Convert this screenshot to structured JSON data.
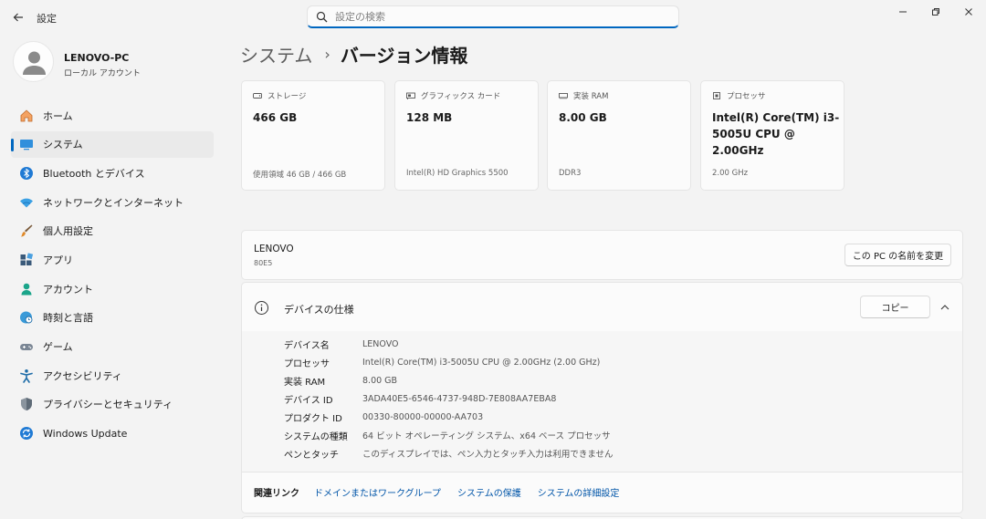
{
  "window": {
    "title": "設定"
  },
  "search": {
    "placeholder": "設定の検索"
  },
  "profile": {
    "name": "LENOVO-PC",
    "account_type": "ローカル アカウント"
  },
  "sidebar": {
    "items": [
      {
        "label": "ホーム",
        "icon": "home-icon"
      },
      {
        "label": "システム",
        "icon": "system-icon",
        "active": true
      },
      {
        "label": "Bluetooth とデバイス",
        "icon": "bluetooth-icon"
      },
      {
        "label": "ネットワークとインターネット",
        "icon": "wifi-icon"
      },
      {
        "label": "個人用設定",
        "icon": "brush-icon"
      },
      {
        "label": "アプリ",
        "icon": "apps-icon"
      },
      {
        "label": "アカウント",
        "icon": "account-icon"
      },
      {
        "label": "時刻と言語",
        "icon": "globe-clock-icon"
      },
      {
        "label": "ゲーム",
        "icon": "gamepad-icon"
      },
      {
        "label": "アクセシビリティ",
        "icon": "accessibility-icon"
      },
      {
        "label": "プライバシーとセキュリティ",
        "icon": "shield-icon"
      },
      {
        "label": "Windows Update",
        "icon": "update-icon"
      }
    ]
  },
  "breadcrumb": {
    "parent": "システム",
    "separator": "›",
    "current": "バージョン情報"
  },
  "cards": [
    {
      "icon": "storage-icon",
      "title": "ストレージ",
      "value": "466 GB",
      "sub": "使用領域 46 GB / 466 GB"
    },
    {
      "icon": "graphics-card-icon",
      "title": "グラフィックス カード",
      "value": "128 MB",
      "sub": "Intel(R) HD Graphics 5500"
    },
    {
      "icon": "ram-icon",
      "title": "実装 RAM",
      "value": "8.00 GB",
      "sub": "DDR3"
    },
    {
      "icon": "processor-icon",
      "title": "プロセッサ",
      "value": "Intel(R) Core(TM) i3-5005U CPU @ 2.00GHz",
      "sub": "2.00 GHz"
    }
  ],
  "device": {
    "name": "LENOVO",
    "model": "80E5",
    "rename_label": "この PC の名前を変更"
  },
  "specs": {
    "title": "デバイスの仕様",
    "copy_label": "コピー",
    "rows": [
      {
        "key": "デバイス名",
        "value": "LENOVO"
      },
      {
        "key": "プロセッサ",
        "value": "Intel(R) Core(TM) i3-5005U CPU @ 2.00GHz (2.00 GHz)"
      },
      {
        "key": "実装 RAM",
        "value": "8.00 GB"
      },
      {
        "key": "デバイス ID",
        "value": "3ADA40E5-6546-4737-948D-7E808AA7EBA8"
      },
      {
        "key": "プロダクト ID",
        "value": "00330-80000-00000-AA703"
      },
      {
        "key": "システムの種類",
        "value": "64 ビット オペレーティング システム、x64 ベース プロセッサ"
      },
      {
        "key": "ペンとタッチ",
        "value": "このディスプレイでは、ペン入力とタッチ入力は利用できません"
      }
    ]
  },
  "related_links": {
    "title": "関連リンク",
    "links": [
      "ドメインまたはワークグループ",
      "システムの保護",
      "システムの詳細設定"
    ]
  },
  "colors": {
    "accent": "#0067c0",
    "background": "#f3f3f3",
    "card": "#fbfbfb",
    "link": "#0055a8"
  }
}
